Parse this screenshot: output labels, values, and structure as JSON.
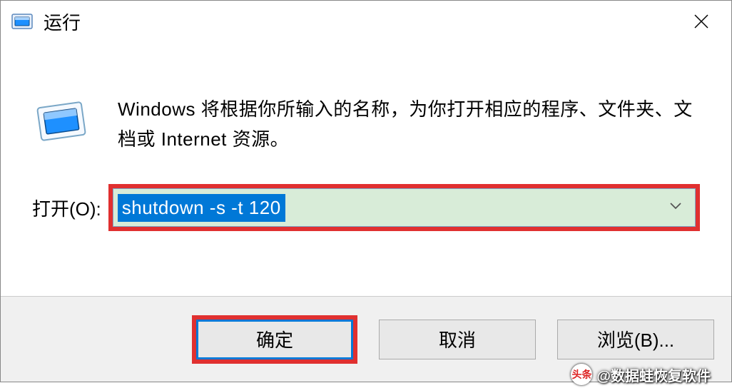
{
  "titlebar": {
    "title": "运行"
  },
  "content": {
    "description": "Windows 将根据你所输入的名称，为你打开相应的程序、文件夹、文档或 Internet 资源。",
    "input_label": "打开(O):",
    "input_value": "shutdown -s -t 120"
  },
  "buttons": {
    "ok": "确定",
    "cancel": "取消",
    "browse": "浏览(B)..."
  },
  "watermark": {
    "badge": "头条",
    "text": "@数据蛙恢复软件"
  }
}
